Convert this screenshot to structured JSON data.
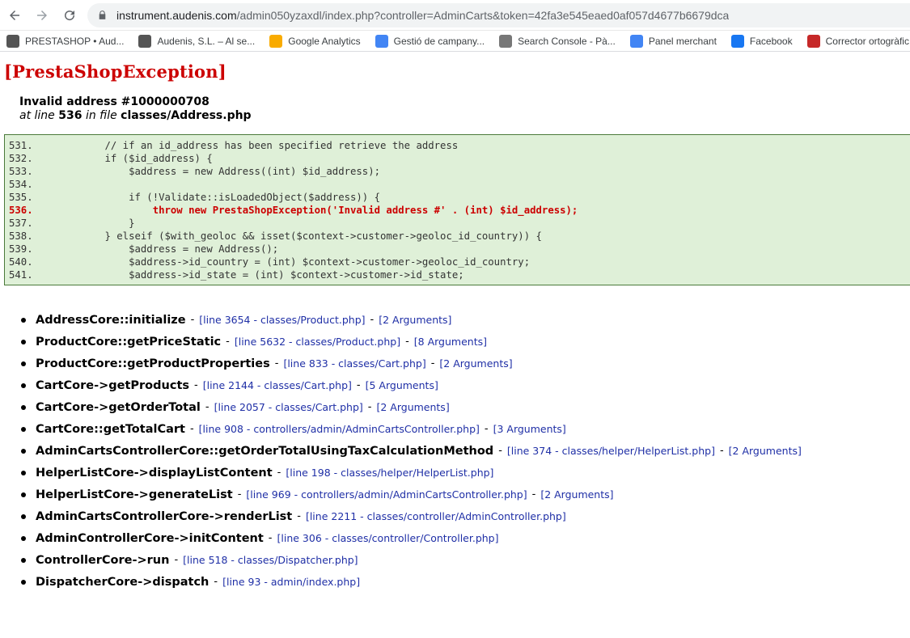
{
  "browser": {
    "url_host": "instrument.audenis.com",
    "url_path": "/admin050yzaxdl/index.php?controller=AdminCarts&token=42fa3e545eaed0af057d4677b6679dca",
    "bookmarks": [
      {
        "label": "PRESTASHOP • Aud...",
        "icon": "prestashop-icon",
        "color": "#555555"
      },
      {
        "label": "Audenis, S.L. – Al se...",
        "icon": "audenis-icon",
        "color": "#555555"
      },
      {
        "label": "Google Analytics",
        "icon": "analytics-icon",
        "color": "#f9ab00"
      },
      {
        "label": "Gestió de campany...",
        "icon": "google-ads-icon",
        "color": "#4285f4"
      },
      {
        "label": "Search Console - Pà...",
        "icon": "search-console-icon",
        "color": "#777777"
      },
      {
        "label": "Panel merchant",
        "icon": "merchant-icon",
        "color": "#4285f4"
      },
      {
        "label": "Facebook",
        "icon": "facebook-icon",
        "color": "#1877f2"
      },
      {
        "label": "Corrector ortogràfic...",
        "icon": "corrector-icon",
        "color": "#c62828"
      }
    ]
  },
  "exception": {
    "title": "[PrestaShopException]",
    "message": "Invalid address #1000000708",
    "at_line_text": "at line",
    "line": "536",
    "in_file_text": "in file",
    "file": "classes/Address.php"
  },
  "code_lines": [
    {
      "num": "531.",
      "code": "            // if an id_address has been specified retrieve the address",
      "error": false
    },
    {
      "num": "532.",
      "code": "            if ($id_address) {",
      "error": false
    },
    {
      "num": "533.",
      "code": "                $address = new Address((int) $id_address);",
      "error": false
    },
    {
      "num": "534.",
      "code": "",
      "error": false
    },
    {
      "num": "535.",
      "code": "                if (!Validate::isLoadedObject($address)) {",
      "error": false
    },
    {
      "num": "536.",
      "code": "                    throw new PrestaShopException('Invalid address #' . (int) $id_address);",
      "error": true
    },
    {
      "num": "537.",
      "code": "                }",
      "error": false
    },
    {
      "num": "538.",
      "code": "            } elseif ($with_geoloc && isset($context->customer->geoloc_id_country)) {",
      "error": false
    },
    {
      "num": "539.",
      "code": "                $address = new Address();",
      "error": false
    },
    {
      "num": "540.",
      "code": "                $address->id_country = (int) $context->customer->geoloc_id_country;",
      "error": false
    },
    {
      "num": "541.",
      "code": "                $address->id_state = (int) $context->customer->id_state;",
      "error": false
    }
  ],
  "trace": [
    {
      "fn": "AddressCore::initialize",
      "loc": "[line 3654 - classes/Product.php]",
      "args": "[2 Arguments]"
    },
    {
      "fn": "ProductCore::getPriceStatic",
      "loc": "[line 5632 - classes/Product.php]",
      "args": "[8 Arguments]"
    },
    {
      "fn": "ProductCore::getProductProperties",
      "loc": "[line 833 - classes/Cart.php]",
      "args": "[2 Arguments]"
    },
    {
      "fn": "CartCore->getProducts",
      "loc": "[line 2144 - classes/Cart.php]",
      "args": "[5 Arguments]"
    },
    {
      "fn": "CartCore->getOrderTotal",
      "loc": "[line 2057 - classes/Cart.php]",
      "args": "[2 Arguments]"
    },
    {
      "fn": "CartCore::getTotalCart",
      "loc": "[line 908 - controllers/admin/AdminCartsController.php]",
      "args": "[3 Arguments]"
    },
    {
      "fn": "AdminCartsControllerCore::getOrderTotalUsingTaxCalculationMethod",
      "loc": "[line 374 - classes/helper/HelperList.php]",
      "args": "[2 Arguments]"
    },
    {
      "fn": "HelperListCore->displayListContent",
      "loc": "[line 198 - classes/helper/HelperList.php]",
      "args": ""
    },
    {
      "fn": "HelperListCore->generateList",
      "loc": "[line 969 - controllers/admin/AdminCartsController.php]",
      "args": "[2 Arguments]"
    },
    {
      "fn": "AdminCartsControllerCore->renderList",
      "loc": "[line 2211 - classes/controller/AdminController.php]",
      "args": ""
    },
    {
      "fn": "AdminControllerCore->initContent",
      "loc": "[line 306 - classes/controller/Controller.php]",
      "args": ""
    },
    {
      "fn": "ControllerCore->run",
      "loc": "[line 518 - classes/Dispatcher.php]",
      "args": ""
    },
    {
      "fn": "DispatcherCore->dispatch",
      "loc": "[line 93 - admin/index.php]",
      "args": ""
    }
  ],
  "separator": "-"
}
